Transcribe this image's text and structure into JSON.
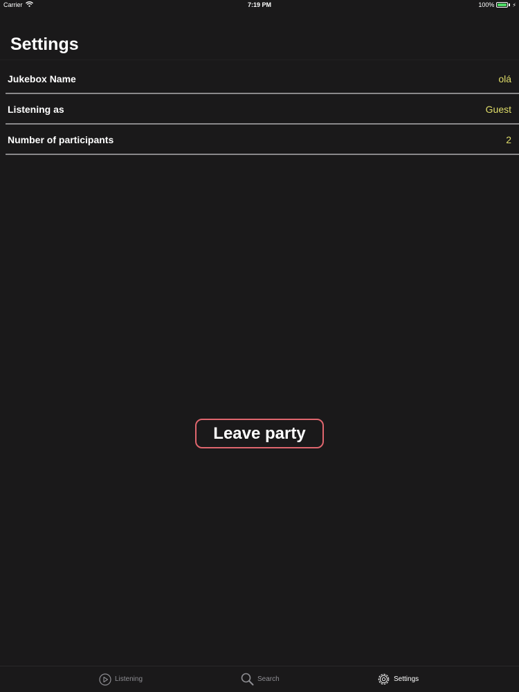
{
  "status_bar": {
    "carrier": "Carrier",
    "time": "7:19 PM",
    "battery": "100%",
    "battery_level": 1.0,
    "battery_color": "#4cd964",
    "icons": [
      "wifi-icon",
      "battery-icon",
      "charging-bolt-icon"
    ]
  },
  "nav": {
    "title": "Settings"
  },
  "settings": {
    "rows": [
      {
        "label": "Jukebox Name",
        "value": "olá"
      },
      {
        "label": "Listening as",
        "value": "Guest"
      },
      {
        "label": "Number of participants",
        "value": "2"
      }
    ],
    "value_color": "#e1de6a"
  },
  "actions": {
    "leave_label": "Leave party",
    "leave_border_color": "#e0666e"
  },
  "tab_bar": {
    "tabs": [
      {
        "label": "Listening",
        "icon": "play-circle-icon",
        "active": false
      },
      {
        "label": "Search",
        "icon": "search-icon",
        "active": false
      },
      {
        "label": "Settings",
        "icon": "gear-icon",
        "active": true
      }
    ]
  },
  "colors": {
    "background": "#1a191a"
  }
}
